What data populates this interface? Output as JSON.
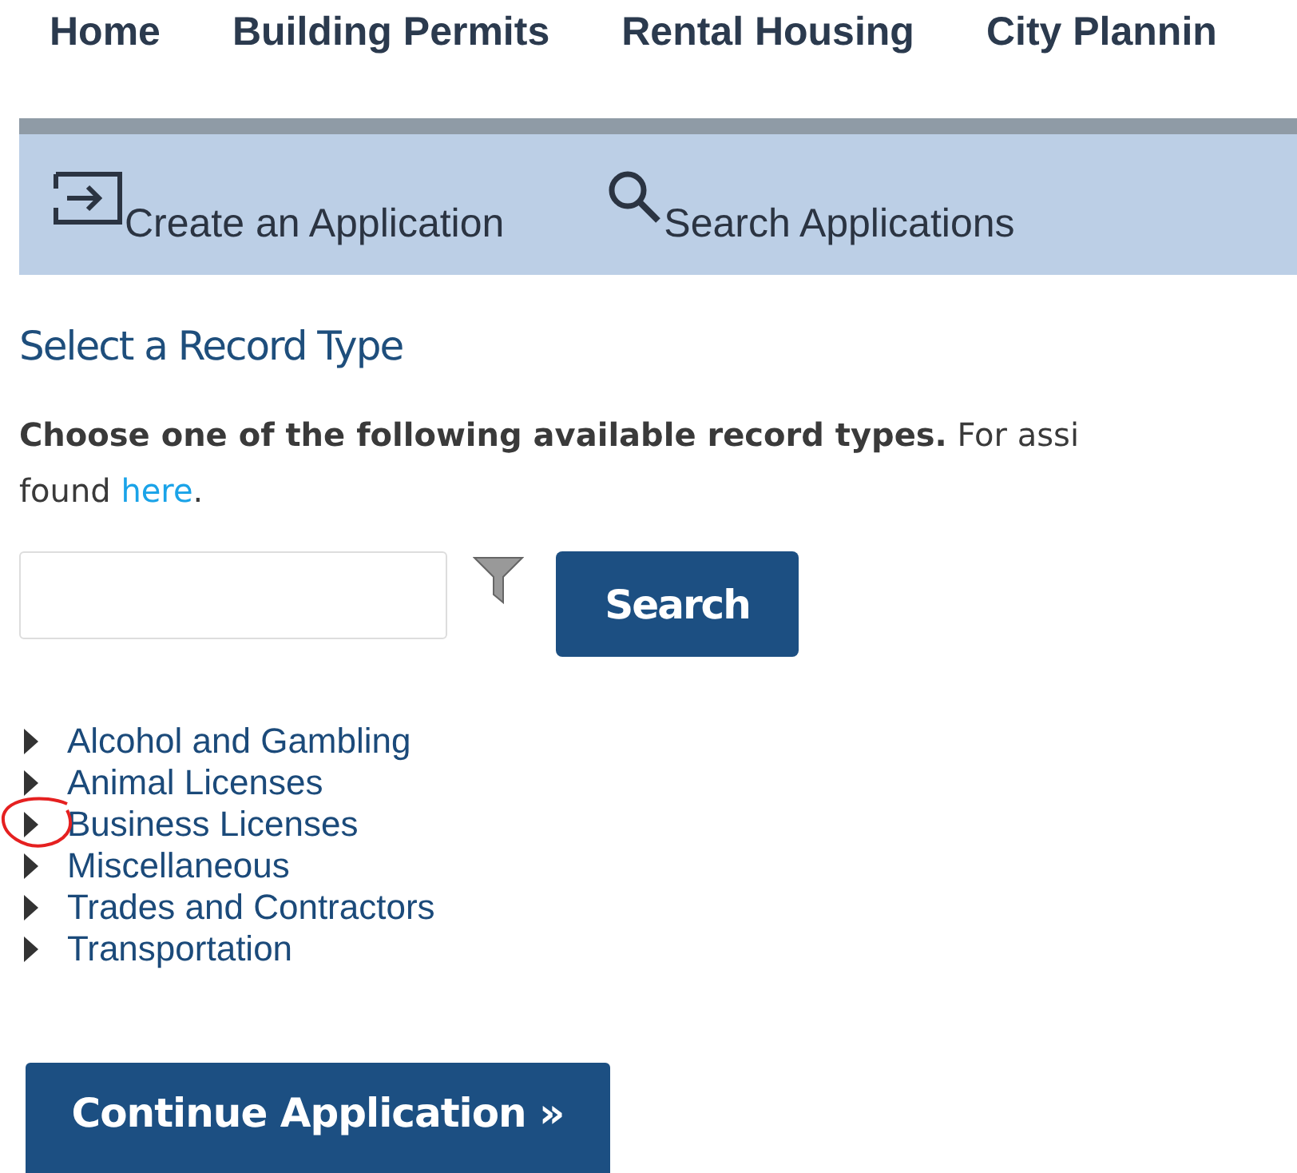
{
  "nav": {
    "items": [
      {
        "label": "Home"
      },
      {
        "label": "Building Permits"
      },
      {
        "label": "Rental Housing"
      },
      {
        "label": "City Plannin"
      }
    ]
  },
  "toolbar": {
    "actions": [
      {
        "kind": "create",
        "label": "Create an Application"
      },
      {
        "kind": "search",
        "label": "Search Applications"
      }
    ]
  },
  "heading": "Select a Record Type",
  "intro": {
    "lines": [
      "**Choose one of the following available record types.** For assi",
      "found "
    ],
    "link": "here",
    "after": "."
  },
  "search": {
    "button": "Search"
  },
  "record_types": [
    {
      "label": "Alcohol and Gambling",
      "expanded": false,
      "circled": false
    },
    {
      "label": "Animal Licenses",
      "expanded": false,
      "circled": false
    },
    {
      "label": "Business Licenses",
      "expanded": false,
      "circled": true
    },
    {
      "label": "Miscellaneous",
      "expanded": false,
      "circled": false
    },
    {
      "label": "Trades and Contractors",
      "expanded": false,
      "circled": false
    },
    {
      "label": "Transportation",
      "expanded": false,
      "circled": false
    }
  ],
  "continue_button": "Continue Application »"
}
